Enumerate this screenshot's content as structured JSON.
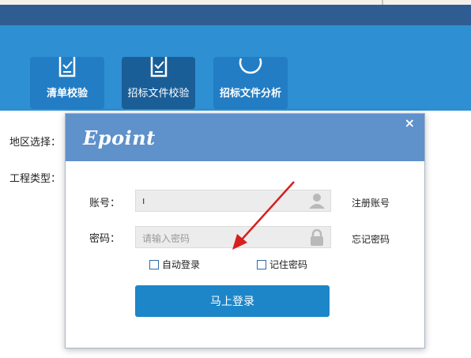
{
  "toolbar": {
    "buttons": [
      {
        "label": "清单校验"
      },
      {
        "label": "招标文件校验"
      },
      {
        "label": "招标文件分析"
      }
    ]
  },
  "form_labels": {
    "region": "地区选择：",
    "project_type": "工程类型："
  },
  "login_dialog": {
    "logo": "Epoint",
    "close_glyph": "×",
    "account_label": "账号：",
    "account_value": "ı",
    "password_label": "密码：",
    "password_placeholder": "请输入密码",
    "register_link": "注册账号",
    "forgot_link": "忘记密码",
    "auto_login": "自动登录",
    "remember_password": "记住密码",
    "login_button": "马上登录"
  },
  "colors": {
    "titlebar": "#2f5d92",
    "toolbar": "#2e8fd2",
    "dialog_header": "#5f91cb",
    "login_button": "#1c86c8",
    "annotation_arrow": "#d62020"
  }
}
